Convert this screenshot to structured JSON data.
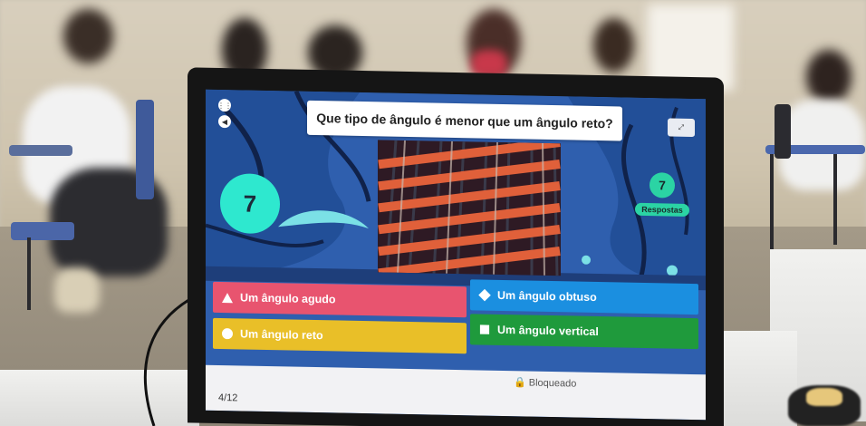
{
  "quiz": {
    "question": "Que tipo de ângulo é menor que um ângulo reto?",
    "timer": "7",
    "answers_count": "7",
    "answers_label": "Respostas",
    "answers": [
      {
        "label": "Um ângulo agudo",
        "shape": "triangle",
        "color": "#e8546f"
      },
      {
        "label": "Um ângulo obtuso",
        "shape": "diamond",
        "color": "#1b8fe0"
      },
      {
        "label": "Um ângulo reto",
        "shape": "circle",
        "color": "#e9bf28"
      },
      {
        "label": "Um ângulo vertical",
        "shape": "square",
        "color": "#1f9a3c"
      }
    ],
    "status": "Bloqueado",
    "progress": "4/12"
  }
}
